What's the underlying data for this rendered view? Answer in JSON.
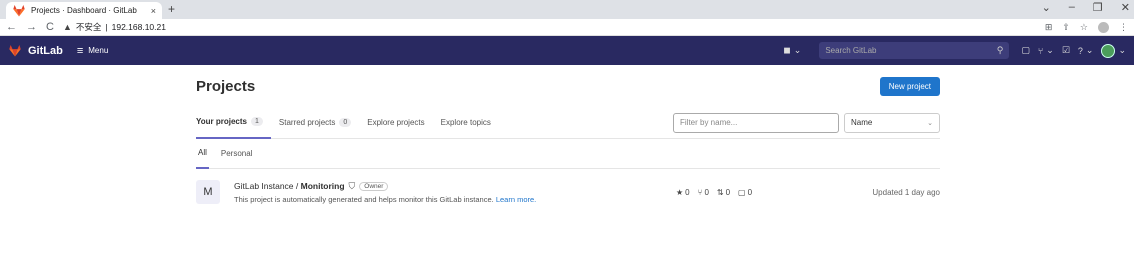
{
  "browser": {
    "tab_title": "Projects · Dashboard · GitLab",
    "tab_close": "×",
    "new_tab": "+",
    "url_warning": "不安全",
    "url_sep": "|",
    "url": "192.168.10.21",
    "controls": {
      "chevron": "⌄",
      "minimize": "–",
      "restore": "❐",
      "close": "✕"
    },
    "nav": {
      "back": "←",
      "forward": "→",
      "reload": "C"
    }
  },
  "header": {
    "brand": "GitLab",
    "menu_label": "Menu",
    "search_placeholder": "Search GitLab"
  },
  "page": {
    "title": "Projects",
    "new_project_label": "New project",
    "tabs": [
      {
        "label": "Your projects",
        "count": "1"
      },
      {
        "label": "Starred projects",
        "count": "0"
      },
      {
        "label": "Explore projects"
      },
      {
        "label": "Explore topics"
      }
    ],
    "filter_placeholder": "Filter by name...",
    "sort_value": "Name",
    "subtabs": [
      "All",
      "Personal"
    ]
  },
  "project": {
    "avatar_letter": "M",
    "namespace": "GitLab Instance / ",
    "name": "Monitoring",
    "role": "Owner",
    "description": "This project is automatically generated and helps monitor this GitLab instance.",
    "learn_more": "Learn more.",
    "stars": "0",
    "forks": "0",
    "merge_requests": "0",
    "issues": "0",
    "updated": "Updated 1 day ago"
  },
  "colors": {
    "header_bg": "#292961",
    "accent": "#1f75cb",
    "tab_underline": "#6666c4"
  }
}
